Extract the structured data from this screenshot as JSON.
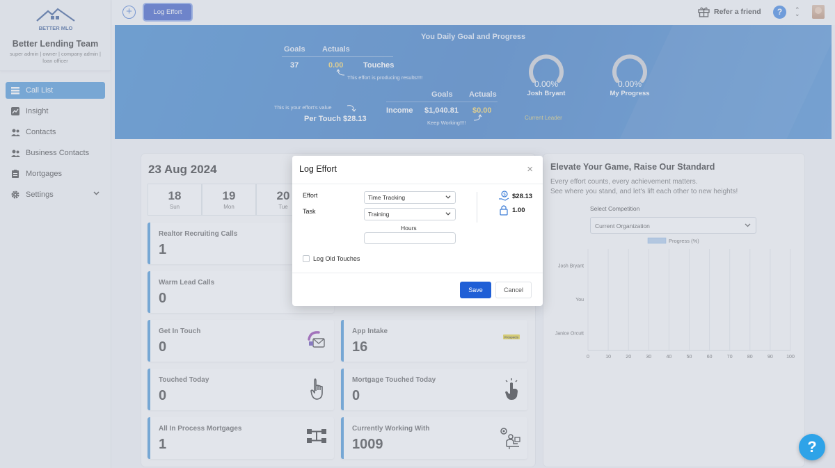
{
  "sidebar": {
    "brand_name": "BETTER MLO",
    "team": "Better Lending Team",
    "roles": "super admin | owner | company admin | loan officer",
    "items": [
      {
        "label": "Call List",
        "icon": "list-icon"
      },
      {
        "label": "Insight",
        "icon": "insight-icon"
      },
      {
        "label": "Contacts",
        "icon": "users-icon"
      },
      {
        "label": "Business Contacts",
        "icon": "users-icon"
      },
      {
        "label": "Mortgages",
        "icon": "clipboard-icon"
      },
      {
        "label": "Settings",
        "icon": "gear-icon"
      }
    ]
  },
  "topbar": {
    "log_effort": "Log Effort",
    "refer": "Refer a friend",
    "help": "?"
  },
  "banner": {
    "title": "You Daily Goal and Progress",
    "goals_label": "Goals",
    "actuals_label": "Actuals",
    "goal_value": "37",
    "actual_value": "0.00",
    "touches_label": "Touches",
    "producing": "This effort is producing results!!!!",
    "goals_label2": "Goals",
    "actuals_label2": "Actuals",
    "income_label": "Income",
    "income_goal": "$1,040.81",
    "income_actual": "$0.00",
    "keep_working": "Keep Working!!!!",
    "effort_value_label": "This is your effort's value",
    "per_touch": "Per Touch $28.13",
    "gauges": [
      {
        "pct": "0.00%",
        "name": "Josh Bryant",
        "progress": 0
      },
      {
        "pct": "0.00%",
        "name": "My Progress",
        "progress": 0
      }
    ],
    "current_leader": "Current Leader"
  },
  "main": {
    "date": "23 Aug 2024",
    "days": [
      {
        "num": "18",
        "wd": "Sun"
      },
      {
        "num": "19",
        "wd": "Mon"
      },
      {
        "num": "20",
        "wd": "Tue"
      }
    ],
    "cards": [
      {
        "title": "Realtor Recruiting Calls",
        "value": "1"
      },
      {
        "title": "Warm Lead Calls",
        "value": "0"
      },
      {
        "title": "Get In Touch",
        "value": "0"
      },
      {
        "title": "App Intake",
        "value": "16"
      },
      {
        "title": "Touched Today",
        "value": "0"
      },
      {
        "title": "Mortgage Touched Today",
        "value": "0"
      },
      {
        "title": "All In Process Mortgages",
        "value": "1"
      },
      {
        "title": "Currently Working With",
        "value": "1009"
      }
    ],
    "app_intake_badge": "Prospects"
  },
  "right": {
    "title": "Elevate Your Game, Raise Our Standard",
    "sub1": "Every effort counts, every achievement matters.",
    "sub2": "See where you stand, and let's lift each other to new heights!",
    "select_label": "Select Competition",
    "select_value": "Current Organization"
  },
  "chart_data": {
    "type": "bar",
    "orientation": "horizontal",
    "categories": [
      "Josh Bryant",
      "You",
      "Janice Orcutt"
    ],
    "series": [
      {
        "name": "Progress (%)",
        "values": [
          0,
          0,
          0
        ]
      }
    ],
    "xlim": [
      0,
      100
    ],
    "xticks": [
      "0",
      "10",
      "20",
      "30",
      "40",
      "50",
      "60",
      "70",
      "80",
      "90",
      "100"
    ],
    "legend": "top",
    "grid": true,
    "color": "#a9c8ec"
  },
  "modal": {
    "title": "Log Effort",
    "effort_label": "Effort",
    "effort_value": "Time Tracking",
    "task_label": "Task",
    "task_value": "Training",
    "hours_label": "Hours",
    "hours_value": "",
    "stat_money": "$28.13",
    "stat_count": "1.00",
    "log_old": "Log Old Touches",
    "save": "Save",
    "cancel": "Cancel"
  },
  "help_fab": "?"
}
